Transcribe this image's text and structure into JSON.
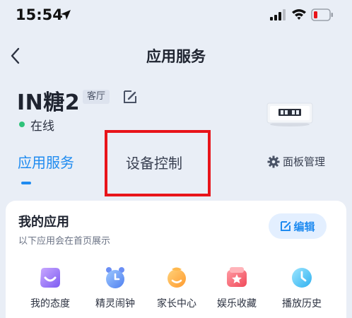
{
  "status_bar": {
    "time": "15:54"
  },
  "nav": {
    "title": "应用服务"
  },
  "device": {
    "name": "IN糖2",
    "room": "客厅",
    "status": "在线"
  },
  "tabs": [
    {
      "label": "应用服务",
      "active": true
    },
    {
      "label": "设备控制",
      "active": false
    }
  ],
  "panel_manage": {
    "label": "面板管理"
  },
  "my_apps": {
    "title": "我的应用",
    "subtitle": "以下应用会在首页展示",
    "edit_label": "编辑",
    "items": [
      {
        "label": "我的态度",
        "icon": "attitude-icon"
      },
      {
        "label": "精灵闹钟",
        "icon": "alarm-clock-icon"
      },
      {
        "label": "家长中心",
        "icon": "parent-center-icon"
      },
      {
        "label": "娱乐收藏",
        "icon": "favorites-icon"
      },
      {
        "label": "播放历史",
        "icon": "play-history-icon"
      }
    ]
  },
  "colors": {
    "accent": "#1f8bf0",
    "online": "#2fc27a",
    "highlight": "#e8141a"
  }
}
